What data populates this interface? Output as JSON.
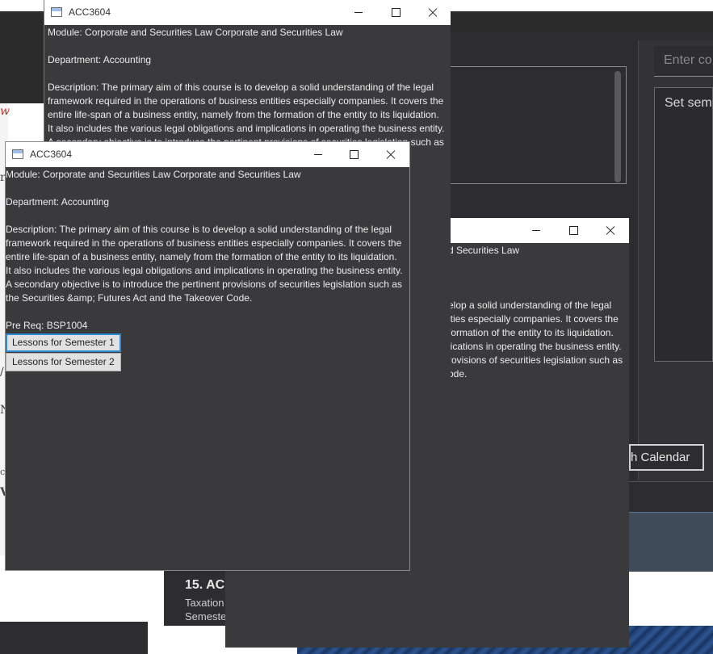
{
  "background": {
    "enter_placeholder": "Enter co",
    "set_label": "Set seme",
    "calendar_button": "h Calendar",
    "list_title": "15.  AC",
    "list_sub1": "Taxation",
    "list_sub2": "Semester",
    "left_glyphs": [
      "w",
      "r",
      "/",
      "N",
      "c",
      "V"
    ]
  },
  "window_c": {
    "lines": [
      "d Securities Law",
      "",
      "",
      "",
      "elop a solid understanding of the legal",
      "ities especially companies. It covers the",
      " formation of the entity to its liquidation.",
      "lications in operating the business entity.",
      "rovisions of securities legislation such as",
      "ode."
    ]
  },
  "window_b": {
    "title": "ACC3604",
    "lines": [
      "Module: Corporate and Securities Law  Corporate and Securities Law",
      "",
      "Department: Accounting",
      "",
      "Description: The primary aim of this course is to develop a solid understanding of the legal",
      "framework required in the operations of business entities especially companies. It covers the",
      "entire life-span of a business entity, namely from the formation of the entity to its liquidation.",
      "It also includes the various legal obligations and implications in operating the business entity.",
      "A secondary objective is to introduce the pertinent provisions of securities legislation such as"
    ]
  },
  "window_a": {
    "title": "ACC3604",
    "module": "Module: Corporate and Securities Law  Corporate and Securities Law",
    "department": "Department: Accounting",
    "description_lines": [
      "Description: The primary aim of this course is to develop a solid understanding of the legal",
      "framework required in the operations of business entities especially companies. It covers the",
      "entire life-span of a business entity, namely from the formation of the entity to its liquidation.",
      "It also includes the various legal obligations and implications in operating the business entity.",
      "A secondary objective is to introduce the pertinent provisions of securities legislation such as",
      "the Securities &amp; Futures Act and the Takeover Code."
    ],
    "prereq": "Pre Req: BSP1004",
    "buttons": [
      "Lessons for Semester 1",
      "Lessons for Semester 2"
    ]
  }
}
